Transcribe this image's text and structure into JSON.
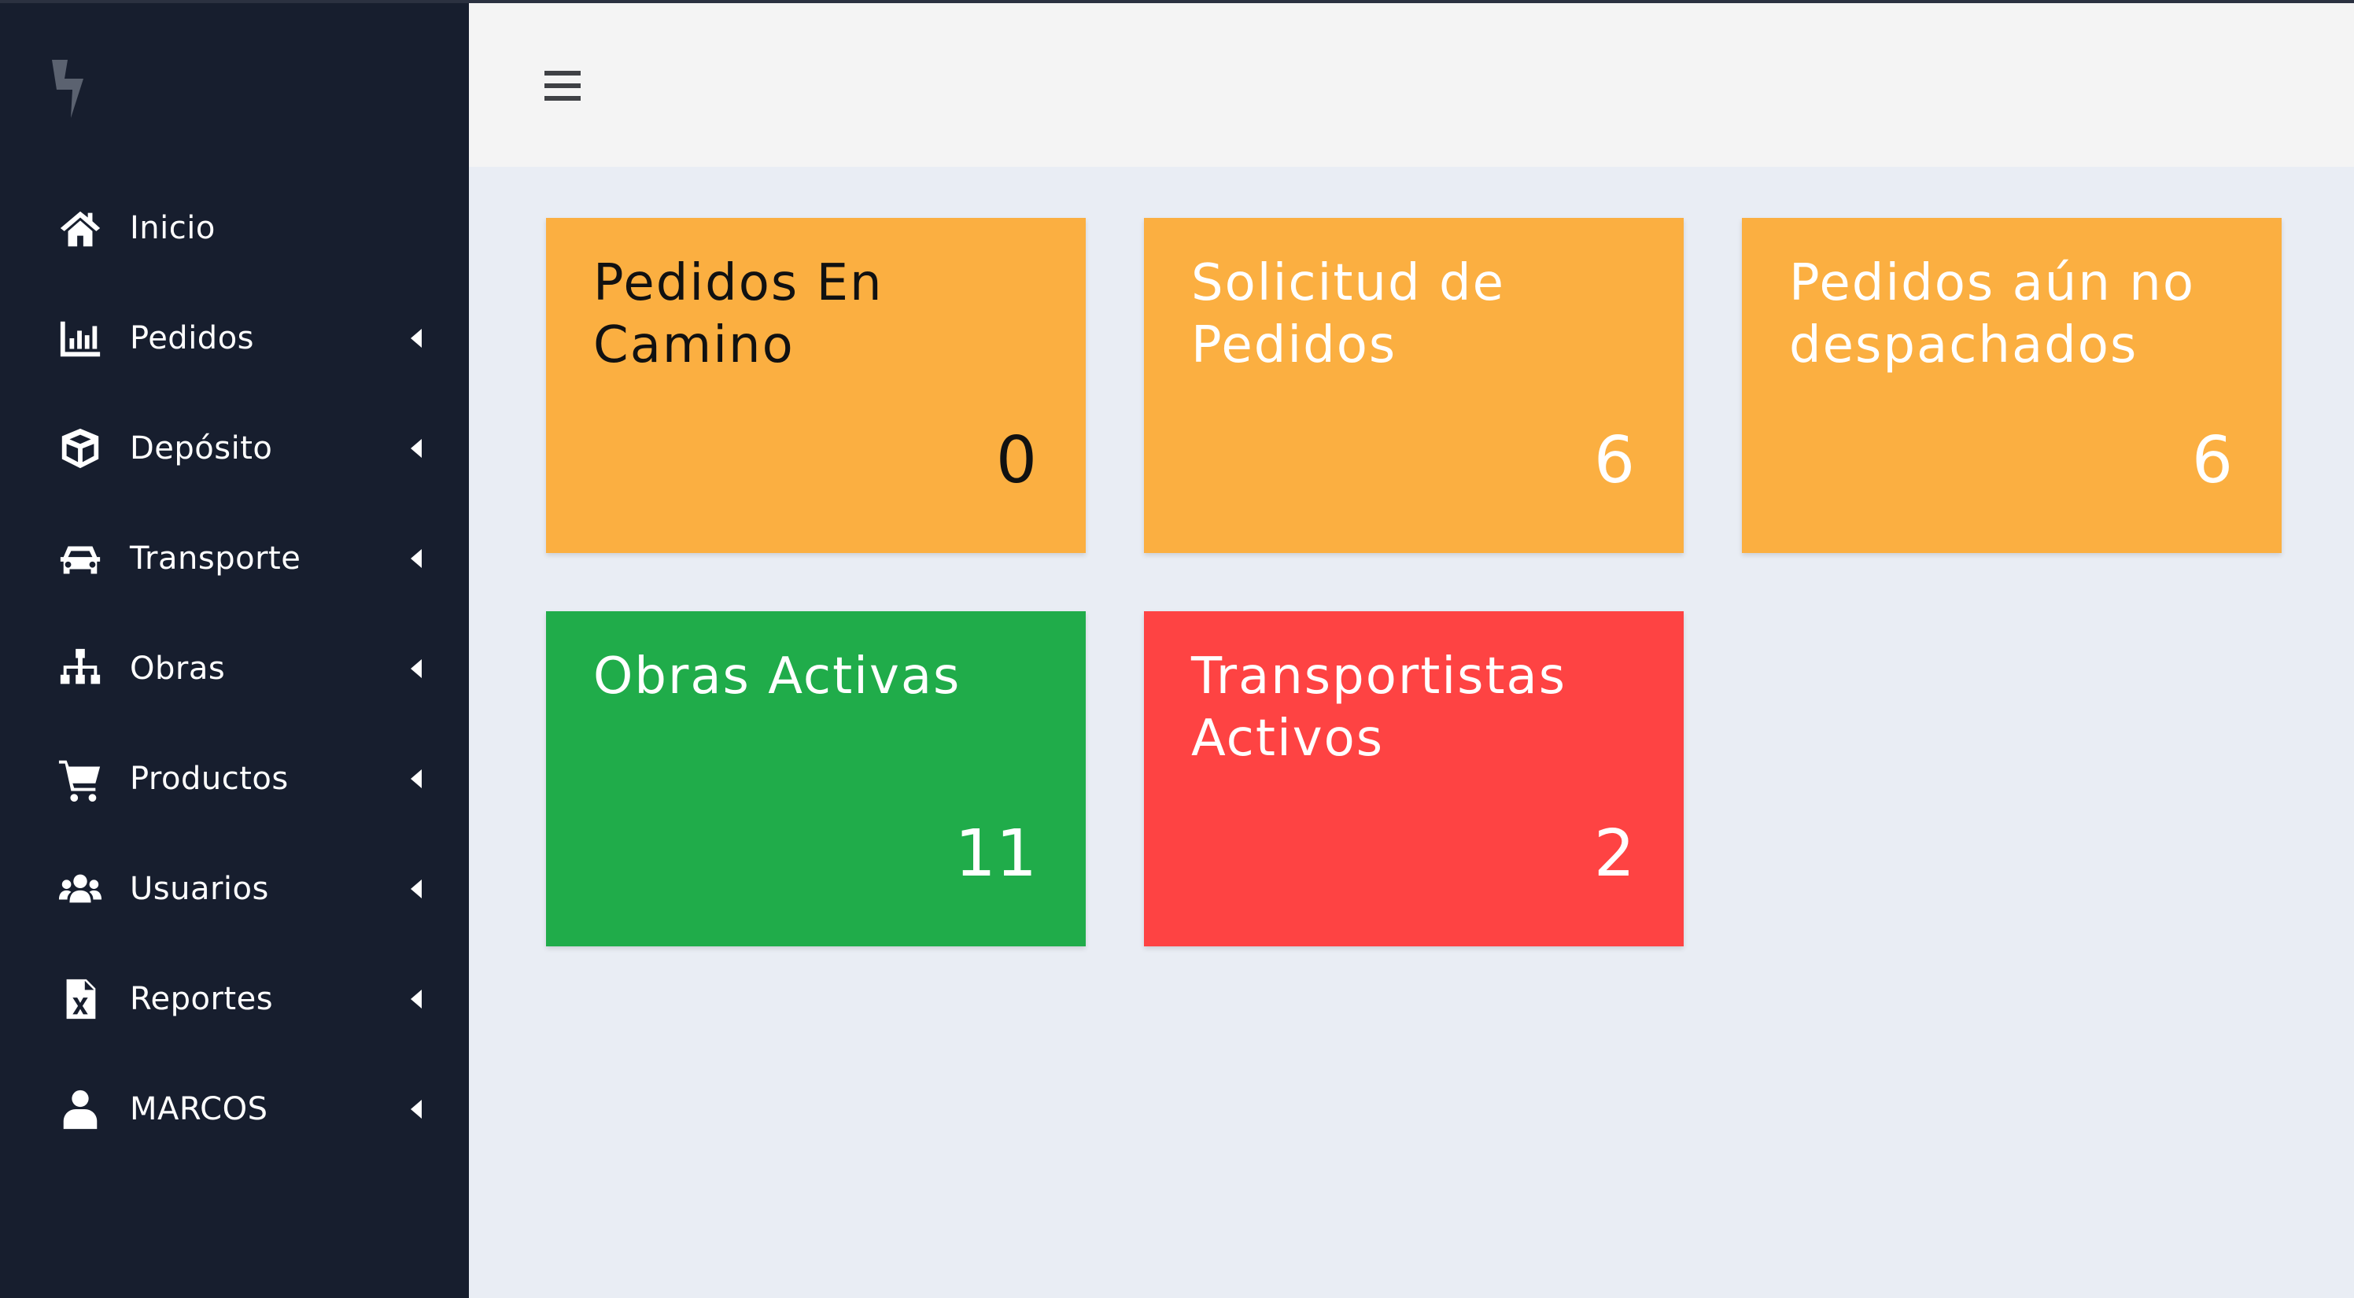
{
  "sidebar": {
    "items": [
      {
        "label": "Inicio",
        "icon": "home-icon",
        "has_caret": false
      },
      {
        "label": "Pedidos",
        "icon": "bar-chart-icon",
        "has_caret": true
      },
      {
        "label": "Depósito",
        "icon": "box-icon",
        "has_caret": true
      },
      {
        "label": "Transporte",
        "icon": "car-icon",
        "has_caret": true
      },
      {
        "label": "Obras",
        "icon": "sitemap-icon",
        "has_caret": true
      },
      {
        "label": "Productos",
        "icon": "shopping-cart-icon",
        "has_caret": true
      },
      {
        "label": "Usuarios",
        "icon": "users-icon",
        "has_caret": true
      },
      {
        "label": "Reportes",
        "icon": "excel-file-icon",
        "has_caret": true
      },
      {
        "label": "MARCOS",
        "icon": "user-icon",
        "has_caret": true
      }
    ]
  },
  "cards": [
    {
      "title": "Pedidos En Camino",
      "value": "0",
      "color": "#fbaf41",
      "text_color": "#111111"
    },
    {
      "title": "Solicitud de Pedidos",
      "value": "6",
      "color": "#fbaf41",
      "text_color": "#ffffff"
    },
    {
      "title": "Pedidos aún no despachados",
      "value": "6",
      "color": "#fbaf41",
      "text_color": "#ffffff"
    },
    {
      "title": "Obras Activas",
      "value": "11",
      "color": "#20ac4a",
      "text_color": "#ffffff"
    },
    {
      "title": "Transportistas Activos",
      "value": "2",
      "color": "#fe4343",
      "text_color": "#ffffff"
    }
  ],
  "colors": {
    "sidebar_bg": "#171e2e",
    "header_bg": "#f4f4f4",
    "content_bg": "#e9edf4",
    "logo": "#5b6270"
  }
}
